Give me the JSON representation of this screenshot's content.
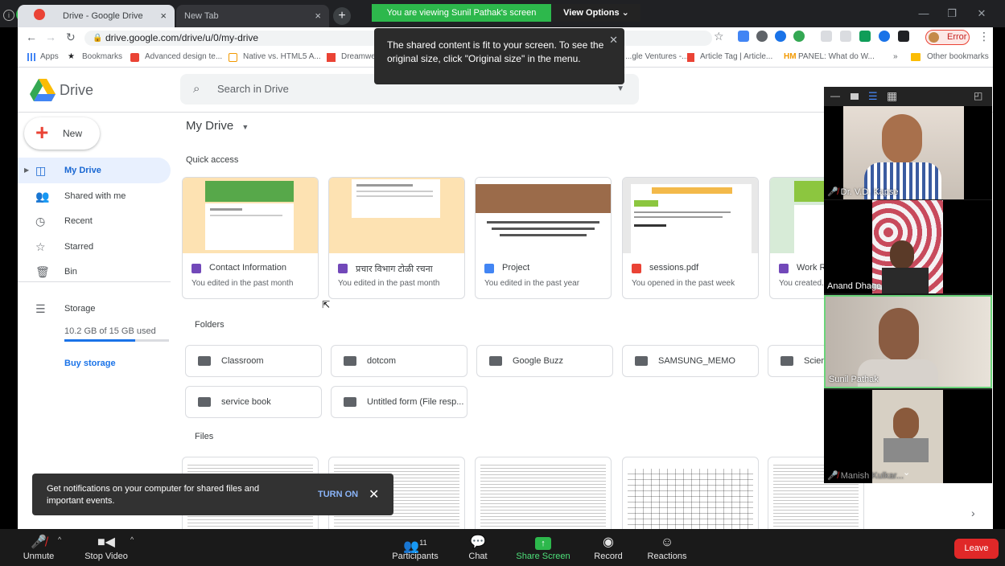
{
  "browser": {
    "tab1_title": "Drive - Google Drive",
    "tab2_title": "New Tab",
    "url": "drive.google.com/drive/u/0/my-drive",
    "error_label": "Error",
    "bookmarks": [
      "Apps",
      "Bookmarks",
      "Advanced design te...",
      "Native vs. HTML5 A...",
      "Dreamwe...",
      "...gle Ventures -...",
      "Article Tag | Article...",
      "PANEL: What do W...",
      "»",
      "Other bookmarks"
    ]
  },
  "zoom_banner": {
    "viewing": "You are viewing Sunil Pathak's screen",
    "view_options": "View Options ⌄"
  },
  "tooltip": {
    "text": "The shared content is fit to your screen. To see the original size, click \"Original size\" in the menu."
  },
  "drive": {
    "brand": "Drive",
    "search_placeholder": "Search in Drive",
    "new_label": "New",
    "sidebar": [
      {
        "label": "My Drive",
        "icon": "drive-icon"
      },
      {
        "label": "Shared with me",
        "icon": "people-icon"
      },
      {
        "label": "Recent",
        "icon": "clock-icon"
      },
      {
        "label": "Starred",
        "icon": "star-icon"
      },
      {
        "label": "Bin",
        "icon": "trash-icon"
      }
    ],
    "storage_label": "Storage",
    "storage_used": "10.2 GB of 15 GB used",
    "storage_fraction": 0.68,
    "buy_storage": "Buy storage",
    "heading": "My Drive",
    "quick_access_label": "Quick access",
    "quick_access": [
      {
        "title": "Contact Information",
        "sub": "You edited in the past month",
        "type": "form"
      },
      {
        "title": "प्रचार विभाग टोळी रचना",
        "sub": "You edited in the past month",
        "type": "form"
      },
      {
        "title": "Project",
        "sub": "You edited in the past year",
        "type": "doc"
      },
      {
        "title": "sessions.pdf",
        "sub": "You opened in the past week",
        "type": "pdf"
      },
      {
        "title": "Work R...",
        "sub": "You created...",
        "type": "form"
      }
    ],
    "folders_label": "Folders",
    "folders": [
      "Classroom",
      "dotcom",
      "Google Buzz",
      "SAMSUNG_MEMO",
      "Scien...",
      "service book",
      "Untitled form (File resp..."
    ],
    "files_label": "Files",
    "notification": {
      "text": "Get notifications on your computer for shared files and important events.",
      "action": "TURN ON"
    }
  },
  "participants_video": [
    {
      "name": "Dr. V.D. Kapse",
      "muted": true
    },
    {
      "name": "Anand Dhage",
      "muted": false
    },
    {
      "name": "Sunil Pathak",
      "muted": false
    },
    {
      "name": "Manish Kulkar...",
      "muted": true
    }
  ],
  "zoom_toolbar": {
    "unmute": "Unmute",
    "stop_video": "Stop Video",
    "participants": "Participants",
    "participant_count": "11",
    "chat": "Chat",
    "share_screen": "Share Screen",
    "record": "Record",
    "reactions": "Reactions",
    "leave": "Leave"
  }
}
